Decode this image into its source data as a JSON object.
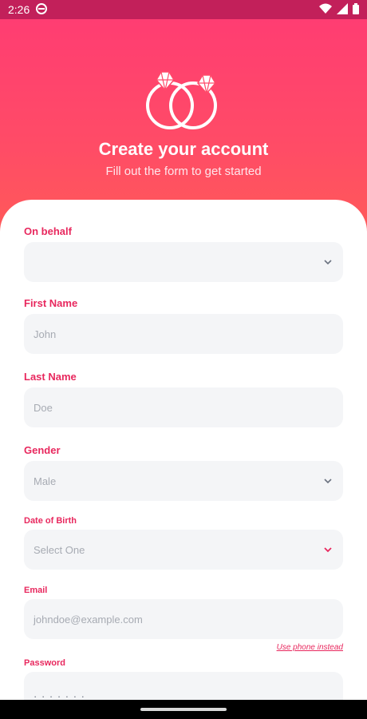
{
  "status": {
    "time": "2:26"
  },
  "header": {
    "title": "Create your account",
    "subtitle": "Fill out the form to get started"
  },
  "form": {
    "on_behalf": {
      "label": "On behalf",
      "value": ""
    },
    "first_name": {
      "label": "First Name",
      "placeholder": "John"
    },
    "last_name": {
      "label": "Last Name",
      "placeholder": "Doe"
    },
    "gender": {
      "label": "Gender",
      "value": "Male"
    },
    "dob": {
      "label": "Date of Birth",
      "placeholder": "Select One"
    },
    "email": {
      "label": "Email",
      "placeholder": "johndoe@example.com",
      "helper": "Use phone instead"
    },
    "password": {
      "label": "Password",
      "placeholder": "· · · · · · ·"
    }
  },
  "colors": {
    "accent": "#e8285e",
    "hero": "#ff3d72",
    "field_bg": "#f4f5f7"
  }
}
